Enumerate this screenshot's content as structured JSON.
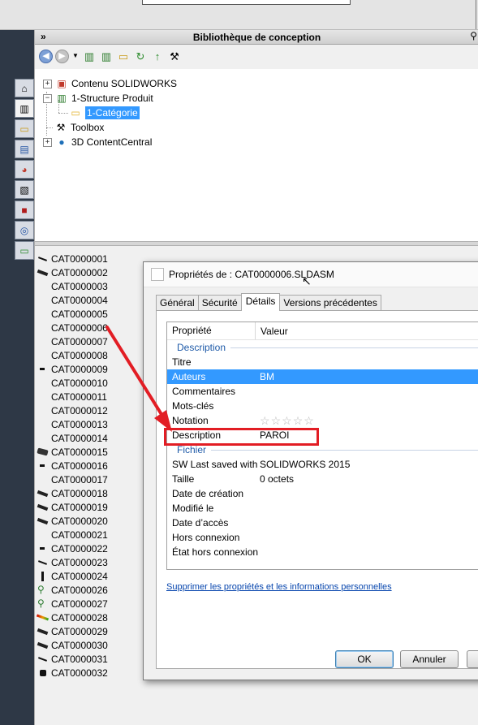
{
  "pane": {
    "title": "Bibliothèque de conception",
    "collapse_glyph": "»",
    "pin_glyph": "⚲"
  },
  "toolbar": {
    "icons": [
      "back-icon",
      "forward-icon",
      "dropdown-icon",
      "add-library-icon",
      "add-file-location-icon",
      "new-folder-icon",
      "refresh-icon",
      "up-icon",
      "toolbox-icon"
    ]
  },
  "side_tabs": {
    "icons": [
      "home-icon",
      "design-library-icon",
      "file-explorer-icon",
      "view-palette-icon",
      "appearances-icon",
      "custom-properties-icon",
      "solidworks-resources-icon",
      "forum-icon",
      "3dcontentcentral-icon"
    ]
  },
  "tree": {
    "items": [
      {
        "label": "Contenu SOLIDWORKS",
        "expander": "+"
      },
      {
        "label": "1-Structure Produit",
        "expander": "−"
      },
      {
        "label": "1-Catégorie",
        "selected": true
      },
      {
        "label": "Toolbox"
      },
      {
        "label": "3D ContentCentral",
        "expander": "+"
      }
    ]
  },
  "files": [
    "CAT0000001",
    "CAT0000002",
    "CAT0000003",
    "CAT0000004",
    "CAT0000005",
    "CAT0000006",
    "CAT0000007",
    "CAT0000008",
    "CAT0000009",
    "CAT0000010",
    "CAT0000011",
    "CAT0000012",
    "CAT0000013",
    "CAT0000014",
    "CAT0000015",
    "CAT0000016",
    "CAT0000017",
    "CAT0000018",
    "CAT0000019",
    "CAT0000020",
    "CAT0000021",
    "CAT0000022",
    "CAT0000023",
    "CAT0000024",
    "CAT0000026",
    "CAT0000027",
    "CAT0000028",
    "CAT0000029",
    "CAT0000030",
    "CAT0000031",
    "CAT0000032"
  ],
  "dialog": {
    "title": "Propriétés de : CAT0000006.SLDASM",
    "tabs": [
      "Général",
      "Sécurité",
      "Détails",
      "Versions précédentes"
    ],
    "active_tab": "Détails",
    "col_property": "Propriété",
    "col_value": "Valeur",
    "group_description": "Description",
    "group_file": "Fichier",
    "rows_description": [
      {
        "name": "Titre",
        "value": ""
      },
      {
        "name": "Auteurs",
        "value": "BM",
        "selected": true
      },
      {
        "name": "Commentaires",
        "value": ""
      },
      {
        "name": "Mots-clés",
        "value": ""
      },
      {
        "name": "Notation",
        "value": ""
      },
      {
        "name": "Description",
        "value": "PAROI"
      }
    ],
    "rating_stars": 0,
    "rows_file": [
      {
        "name": "SW Last saved with",
        "value": "SOLIDWORKS 2015"
      },
      {
        "name": "Taille",
        "value": "0 octets"
      },
      {
        "name": "Date de création",
        "value": ""
      },
      {
        "name": "Modifié le",
        "value": ""
      },
      {
        "name": "Date d’accès",
        "value": ""
      },
      {
        "name": "Hors connexion",
        "value": ""
      },
      {
        "name": "État hors connexion",
        "value": ""
      }
    ],
    "remove_link": "Supprimer les propriétés et les informations personnelles",
    "ok_label": "OK",
    "cancel_label": "Annuler"
  },
  "colors": {
    "selection": "#3399ff",
    "annotation_red": "#e21d24",
    "dark_background": "#2d3745"
  }
}
